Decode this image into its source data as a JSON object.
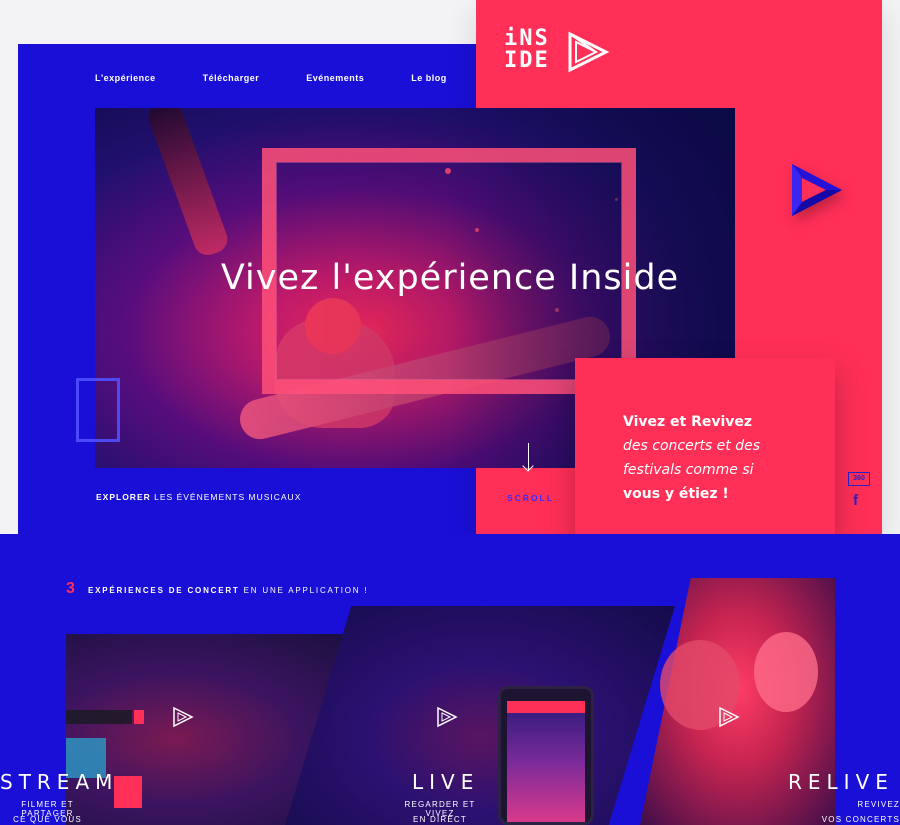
{
  "nav": {
    "items": [
      "L'expérience",
      "Télécharger",
      "Evénements",
      "Le blog"
    ]
  },
  "logo": {
    "line1": "iNS",
    "line2": "IDE"
  },
  "hero": {
    "title": "Vivez l'expérience Inside",
    "explore_bold": "EXPLORER",
    "explore_rest": "LES ÉVÉNEMENTS MUSICAUX",
    "scroll": "SCROLL"
  },
  "promo": {
    "line1": "Vivez et Revivez",
    "line2": "des concerts et des",
    "line3": "festivals comme si",
    "line4": "vous y étiez !"
  },
  "social": {
    "badge_360": "360",
    "facebook": "f"
  },
  "experiences": {
    "count": "3",
    "label_bold": "EXPÉRIENCES DE CONCERT",
    "label_rest": "EN UNE APPLICATION !",
    "panels": [
      {
        "title": "STREAM",
        "sub1": "FILMER ET PARTAGER",
        "sub2": "CE QUE VOUS VIVEZ"
      },
      {
        "title": "LIVE",
        "sub1": "REGARDER ET VIVEZ",
        "sub2": "EN DIRECT"
      },
      {
        "title": "RELIVE",
        "sub1": "REVIVEZ",
        "sub2": "VOS CONCERTS"
      }
    ]
  },
  "colors": {
    "blue": "#1a0fd6",
    "pink": "#ff2f57"
  }
}
